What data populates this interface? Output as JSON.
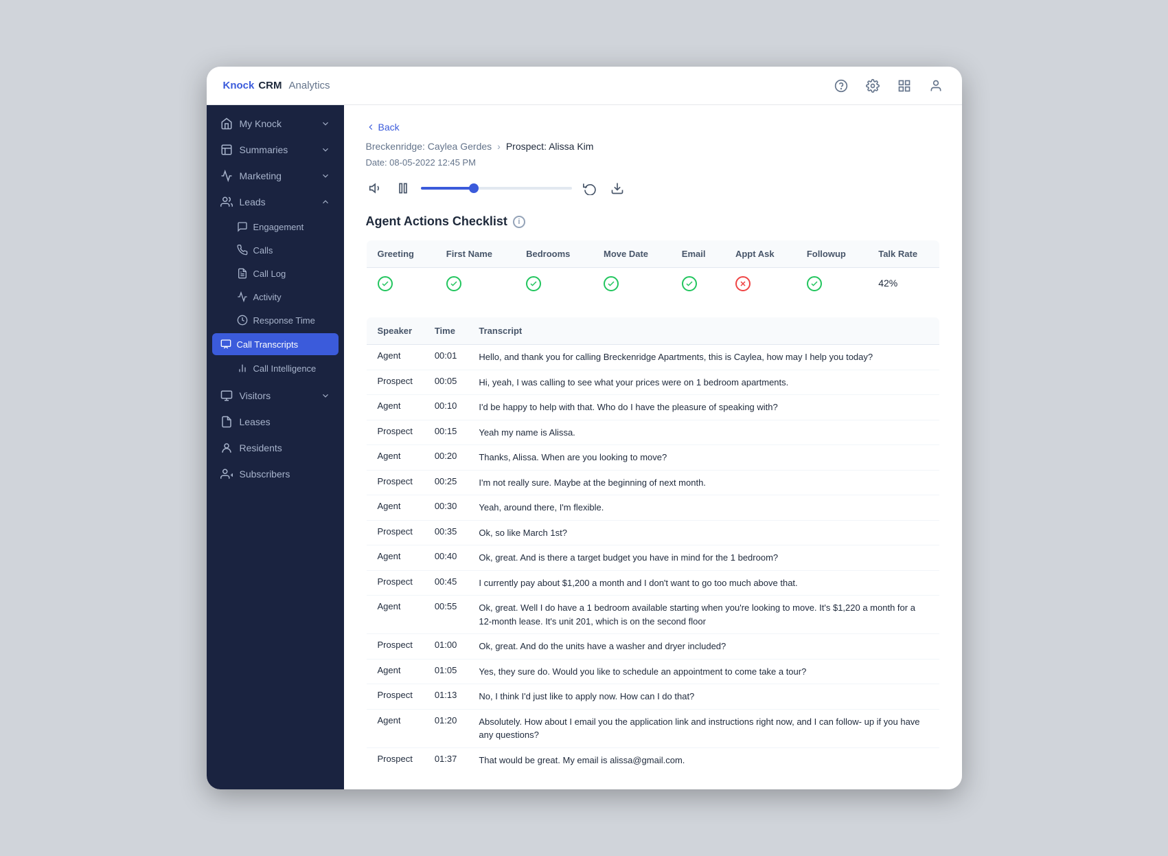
{
  "app": {
    "brand_knock": "Knock",
    "brand_crm": "CRM",
    "brand_analytics": "Analytics"
  },
  "topbar_icons": [
    "help-icon",
    "settings-icon",
    "grid-icon",
    "user-icon"
  ],
  "sidebar": {
    "items": [
      {
        "id": "my-knock",
        "label": "My Knock",
        "hasChevron": true
      },
      {
        "id": "summaries",
        "label": "Summaries",
        "hasChevron": true
      },
      {
        "id": "marketing",
        "label": "Marketing",
        "hasChevron": true
      },
      {
        "id": "leads",
        "label": "Leads",
        "hasChevron": true,
        "expanded": true
      }
    ],
    "leads_subitems": [
      {
        "id": "engagement",
        "label": "Engagement"
      },
      {
        "id": "calls",
        "label": "Calls"
      },
      {
        "id": "call-log",
        "label": "Call Log"
      },
      {
        "id": "activity",
        "label": "Activity"
      },
      {
        "id": "response-time",
        "label": "Response Time"
      },
      {
        "id": "call-transcripts",
        "label": "Call Transcripts",
        "active": true
      },
      {
        "id": "call-intelligence",
        "label": "Call Intelligence"
      }
    ],
    "bottom_items": [
      {
        "id": "visitors",
        "label": "Visitors",
        "hasChevron": true
      },
      {
        "id": "leases",
        "label": "Leases"
      },
      {
        "id": "residents",
        "label": "Residents"
      },
      {
        "id": "subscribers",
        "label": "Subscribers"
      }
    ]
  },
  "content": {
    "back_label": "Back",
    "breadcrumb_parent": "Breckenridge: Caylea Gerdes",
    "breadcrumb_child": "Prospect: Alissa Kim",
    "date_label": "Date: 08-05-2022 12:45 PM",
    "checklist_title": "Agent Actions Checklist",
    "checklist_columns": [
      "Greeting",
      "First Name",
      "Bedrooms",
      "Move Date",
      "Email",
      "Appt Ask",
      "Followup",
      "Talk Rate"
    ],
    "checklist_values": [
      "green",
      "green",
      "green",
      "green",
      "green",
      "red",
      "green",
      "42%"
    ],
    "transcript_columns": [
      "Speaker",
      "Time",
      "Transcript"
    ],
    "transcript_rows": [
      {
        "speaker": "Agent",
        "time": "00:01",
        "text": "Hello, and thank you for calling Breckenridge Apartments, this is Caylea, how may I help you today?"
      },
      {
        "speaker": "Prospect",
        "time": "00:05",
        "text": "Hi, yeah, I was calling to see what your prices were on 1 bedroom apartments."
      },
      {
        "speaker": "Agent",
        "time": "00:10",
        "text": "I'd be happy to help with that. Who do I have the pleasure of speaking with?"
      },
      {
        "speaker": "Prospect",
        "time": "00:15",
        "text": "Yeah my name is Alissa."
      },
      {
        "speaker": "Agent",
        "time": "00:20",
        "text": "Thanks, Alissa. When are you looking to move?"
      },
      {
        "speaker": "Prospect",
        "time": "00:25",
        "text": "I'm not really sure. Maybe at the beginning of next month."
      },
      {
        "speaker": "Agent",
        "time": "00:30",
        "text": "Yeah, around there, I'm flexible."
      },
      {
        "speaker": "Prospect",
        "time": "00:35",
        "text": "Ok, so like March 1st?"
      },
      {
        "speaker": "Agent",
        "time": "00:40",
        "text": "Ok, great. And is there a target budget you have in mind for the 1 bedroom?"
      },
      {
        "speaker": "Prospect",
        "time": "00:45",
        "text": " I currently pay about $1,200 a month and I don't want to go too much above that."
      },
      {
        "speaker": "Agent",
        "time": "00:55",
        "text": "Ok, great. Well I do have a 1 bedroom available starting when you're looking to move. It's $1,220 a month for a 12-month lease. It's unit 201, which is on the second floor"
      },
      {
        "speaker": "Prospect",
        "time": "01:00",
        "text": "Ok, great. And do the units have a washer and dryer included?"
      },
      {
        "speaker": "Agent",
        "time": "01:05",
        "text": "Yes, they sure do. Would you like to schedule an appointment to come take a tour?"
      },
      {
        "speaker": "Prospect",
        "time": "01:13",
        "text": "No, I think I'd just like to apply now. How can I do that?"
      },
      {
        "speaker": "Agent",
        "time": "01:20",
        "text": "Absolutely. How about I email you the application link and instructions right now, and I can follow- up if you have any questions?"
      },
      {
        "speaker": "Prospect",
        "time": "01:37",
        "text": "That would be great. My email is alissa@gmail.com."
      }
    ]
  }
}
